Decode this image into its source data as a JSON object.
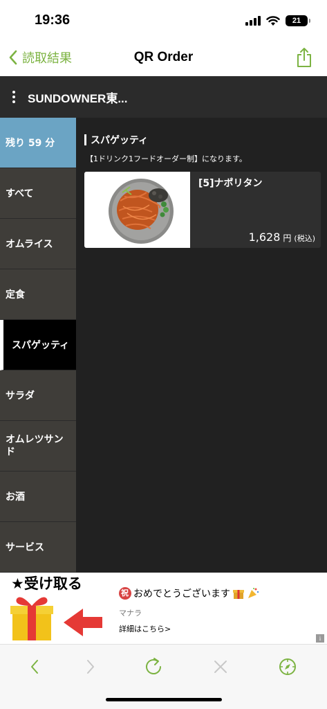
{
  "status_bar": {
    "time": "19:36",
    "battery": "21"
  },
  "nav": {
    "back_label": "読取結果",
    "title": "QR Order"
  },
  "shop": {
    "name": "SUNDOWNER東..."
  },
  "sidebar": {
    "timer": "残り 59 分",
    "items": [
      {
        "label": "すべて",
        "active": false
      },
      {
        "label": "オムライス",
        "active": false
      },
      {
        "label": "定食",
        "active": false
      },
      {
        "label": "スパゲッティ",
        "active": true
      },
      {
        "label": "サラダ",
        "active": false
      },
      {
        "label": "オムレツサンド",
        "active": false
      },
      {
        "label": "お酒",
        "active": false
      },
      {
        "label": "サービス",
        "active": false
      }
    ]
  },
  "content": {
    "category_title": "スパゲッティ",
    "note": "【1ドリンク1フードオーダー制】になります。",
    "menu_items": [
      {
        "name": "[5]ナポリタン",
        "price": "1,628",
        "unit": "円",
        "tax": "(税込)"
      }
    ]
  },
  "ad": {
    "receive_label": "★受け取る",
    "headline_badge": "祝",
    "headline": "おめでとうございます",
    "source": "マナラ",
    "link": "詳細はこちら>",
    "info": "i"
  },
  "colors": {
    "accent": "#7cb342",
    "timer_bg": "#6ba4c4",
    "sidebar_bg": "#3f3d39",
    "content_bg": "#212121"
  }
}
